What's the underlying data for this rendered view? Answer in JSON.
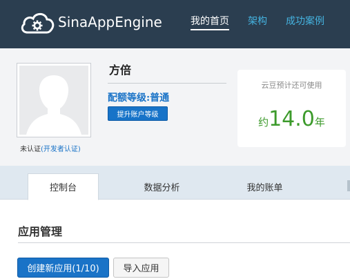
{
  "header": {
    "logo_text": "SinaAppEngine",
    "nav": [
      {
        "label": "我的首页",
        "active": true
      },
      {
        "label": "架构",
        "active": false
      },
      {
        "label": "成功案例",
        "active": false
      }
    ],
    "bg_color": "#2b3e50"
  },
  "profile": {
    "name": "方倍",
    "quota_level": "配额等级:普通",
    "upgrade_button": "提升账户等级",
    "verify_status": "未认证",
    "verify_link": "(开发者认证)",
    "cloud_label": "云豆预计还可使用",
    "cloud_prefix": "约",
    "cloud_years": "14.0",
    "cloud_suffix": "年",
    "accent_green": "#3c9a2b"
  },
  "tabs": [
    {
      "label": "控制台",
      "active": true
    },
    {
      "label": "数据分析",
      "active": false
    },
    {
      "label": "我的账单",
      "active": false
    }
  ],
  "apps": {
    "title": "应用管理",
    "create_button": "创建新应用(1/10)",
    "import_button": "导入应用"
  },
  "icons": [
    "cloud-gear-icon",
    "avatar-placeholder-icon"
  ]
}
